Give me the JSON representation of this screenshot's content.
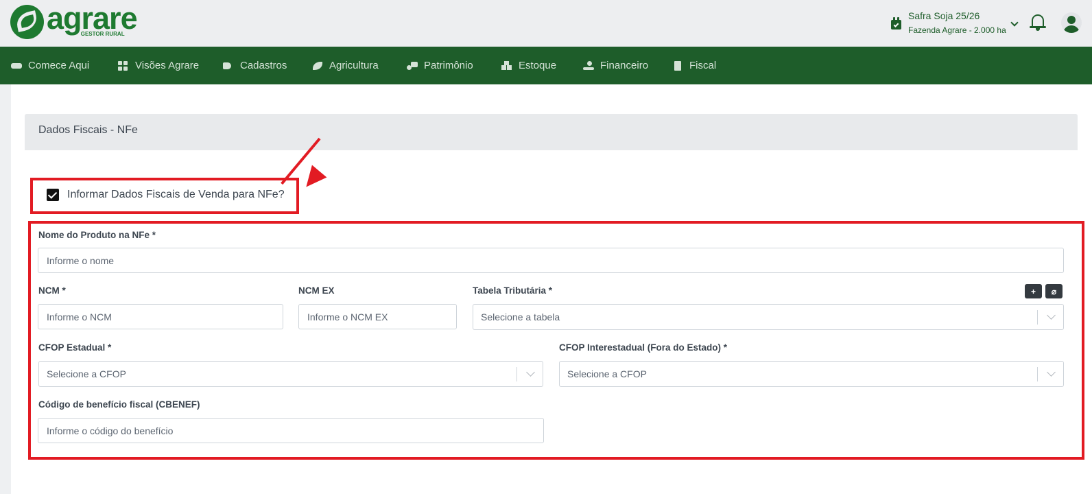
{
  "header": {
    "logo_text": "agrare",
    "logo_sub": "GESTOR RURAL",
    "safra_title": "Safra Soja 25/26",
    "safra_sub": "Fazenda Agrare - 2.000 ha"
  },
  "nav": {
    "items": [
      {
        "label": "Comece Aqui",
        "icon": "handshake-icon"
      },
      {
        "label": "Visões Agrare",
        "icon": "dashboard-icon"
      },
      {
        "label": "Cadastros",
        "icon": "tags-icon"
      },
      {
        "label": "Agricultura",
        "icon": "leaf-icon"
      },
      {
        "label": "Patrimônio",
        "icon": "tractor-icon"
      },
      {
        "label": "Estoque",
        "icon": "boxes-icon"
      },
      {
        "label": "Financeiro",
        "icon": "hand-money-icon"
      },
      {
        "label": "Fiscal",
        "icon": "file-invoice-icon"
      }
    ]
  },
  "card": {
    "title": "Dados Fiscais - NFe",
    "checkbox_label": "Informar Dados Fiscais de Venda para NFe?",
    "checkbox_checked": true
  },
  "form": {
    "nome_label": "Nome do Produto na NFe *",
    "nome_placeholder": "Informe o nome",
    "ncm_label": "NCM *",
    "ncm_placeholder": "Informe o NCM",
    "ncmex_label": "NCM EX",
    "ncmex_placeholder": "Informe o NCM EX",
    "tabela_label": "Tabela Tributária *",
    "tabela_placeholder": "Selecione a tabela",
    "add_button": "+",
    "refresh_button": "⌀",
    "cfop_est_label": "CFOP Estadual *",
    "cfop_est_placeholder": "Selecione a CFOP",
    "cfop_inter_label": "CFOP Interestadual (Fora do Estado) *",
    "cfop_inter_placeholder": "Selecione a CFOP",
    "cbenef_label": "Código de benefício fiscal (CBENEF)",
    "cbenef_placeholder": "Informe o código do benefício"
  },
  "colors": {
    "brand_green": "#1e7a30",
    "nav_green": "#1e5d2a",
    "highlight_red": "#e21b23"
  }
}
